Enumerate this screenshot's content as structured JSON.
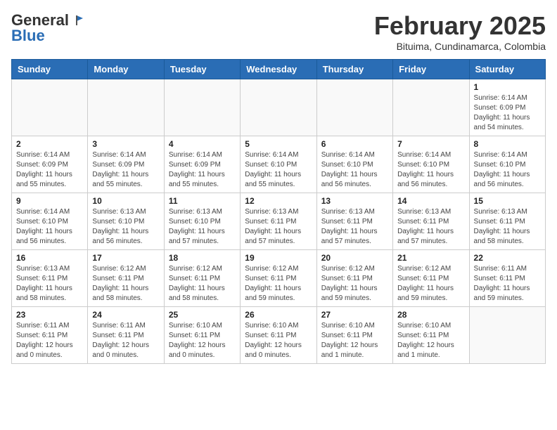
{
  "header": {
    "logo_general": "General",
    "logo_blue": "Blue",
    "month": "February 2025",
    "location": "Bituima, Cundinamarca, Colombia"
  },
  "weekdays": [
    "Sunday",
    "Monday",
    "Tuesday",
    "Wednesday",
    "Thursday",
    "Friday",
    "Saturday"
  ],
  "weeks": [
    [
      {
        "day": "",
        "info": ""
      },
      {
        "day": "",
        "info": ""
      },
      {
        "day": "",
        "info": ""
      },
      {
        "day": "",
        "info": ""
      },
      {
        "day": "",
        "info": ""
      },
      {
        "day": "",
        "info": ""
      },
      {
        "day": "1",
        "info": "Sunrise: 6:14 AM\nSunset: 6:09 PM\nDaylight: 11 hours and 54 minutes."
      }
    ],
    [
      {
        "day": "2",
        "info": "Sunrise: 6:14 AM\nSunset: 6:09 PM\nDaylight: 11 hours and 55 minutes."
      },
      {
        "day": "3",
        "info": "Sunrise: 6:14 AM\nSunset: 6:09 PM\nDaylight: 11 hours and 55 minutes."
      },
      {
        "day": "4",
        "info": "Sunrise: 6:14 AM\nSunset: 6:09 PM\nDaylight: 11 hours and 55 minutes."
      },
      {
        "day": "5",
        "info": "Sunrise: 6:14 AM\nSunset: 6:10 PM\nDaylight: 11 hours and 55 minutes."
      },
      {
        "day": "6",
        "info": "Sunrise: 6:14 AM\nSunset: 6:10 PM\nDaylight: 11 hours and 56 minutes."
      },
      {
        "day": "7",
        "info": "Sunrise: 6:14 AM\nSunset: 6:10 PM\nDaylight: 11 hours and 56 minutes."
      },
      {
        "day": "8",
        "info": "Sunrise: 6:14 AM\nSunset: 6:10 PM\nDaylight: 11 hours and 56 minutes."
      }
    ],
    [
      {
        "day": "9",
        "info": "Sunrise: 6:14 AM\nSunset: 6:10 PM\nDaylight: 11 hours and 56 minutes."
      },
      {
        "day": "10",
        "info": "Sunrise: 6:13 AM\nSunset: 6:10 PM\nDaylight: 11 hours and 56 minutes."
      },
      {
        "day": "11",
        "info": "Sunrise: 6:13 AM\nSunset: 6:10 PM\nDaylight: 11 hours and 57 minutes."
      },
      {
        "day": "12",
        "info": "Sunrise: 6:13 AM\nSunset: 6:11 PM\nDaylight: 11 hours and 57 minutes."
      },
      {
        "day": "13",
        "info": "Sunrise: 6:13 AM\nSunset: 6:11 PM\nDaylight: 11 hours and 57 minutes."
      },
      {
        "day": "14",
        "info": "Sunrise: 6:13 AM\nSunset: 6:11 PM\nDaylight: 11 hours and 57 minutes."
      },
      {
        "day": "15",
        "info": "Sunrise: 6:13 AM\nSunset: 6:11 PM\nDaylight: 11 hours and 58 minutes."
      }
    ],
    [
      {
        "day": "16",
        "info": "Sunrise: 6:13 AM\nSunset: 6:11 PM\nDaylight: 11 hours and 58 minutes."
      },
      {
        "day": "17",
        "info": "Sunrise: 6:12 AM\nSunset: 6:11 PM\nDaylight: 11 hours and 58 minutes."
      },
      {
        "day": "18",
        "info": "Sunrise: 6:12 AM\nSunset: 6:11 PM\nDaylight: 11 hours and 58 minutes."
      },
      {
        "day": "19",
        "info": "Sunrise: 6:12 AM\nSunset: 6:11 PM\nDaylight: 11 hours and 59 minutes."
      },
      {
        "day": "20",
        "info": "Sunrise: 6:12 AM\nSunset: 6:11 PM\nDaylight: 11 hours and 59 minutes."
      },
      {
        "day": "21",
        "info": "Sunrise: 6:12 AM\nSunset: 6:11 PM\nDaylight: 11 hours and 59 minutes."
      },
      {
        "day": "22",
        "info": "Sunrise: 6:11 AM\nSunset: 6:11 PM\nDaylight: 11 hours and 59 minutes."
      }
    ],
    [
      {
        "day": "23",
        "info": "Sunrise: 6:11 AM\nSunset: 6:11 PM\nDaylight: 12 hours and 0 minutes."
      },
      {
        "day": "24",
        "info": "Sunrise: 6:11 AM\nSunset: 6:11 PM\nDaylight: 12 hours and 0 minutes."
      },
      {
        "day": "25",
        "info": "Sunrise: 6:10 AM\nSunset: 6:11 PM\nDaylight: 12 hours and 0 minutes."
      },
      {
        "day": "26",
        "info": "Sunrise: 6:10 AM\nSunset: 6:11 PM\nDaylight: 12 hours and 0 minutes."
      },
      {
        "day": "27",
        "info": "Sunrise: 6:10 AM\nSunset: 6:11 PM\nDaylight: 12 hours and 1 minute."
      },
      {
        "day": "28",
        "info": "Sunrise: 6:10 AM\nSunset: 6:11 PM\nDaylight: 12 hours and 1 minute."
      },
      {
        "day": "",
        "info": ""
      }
    ]
  ]
}
